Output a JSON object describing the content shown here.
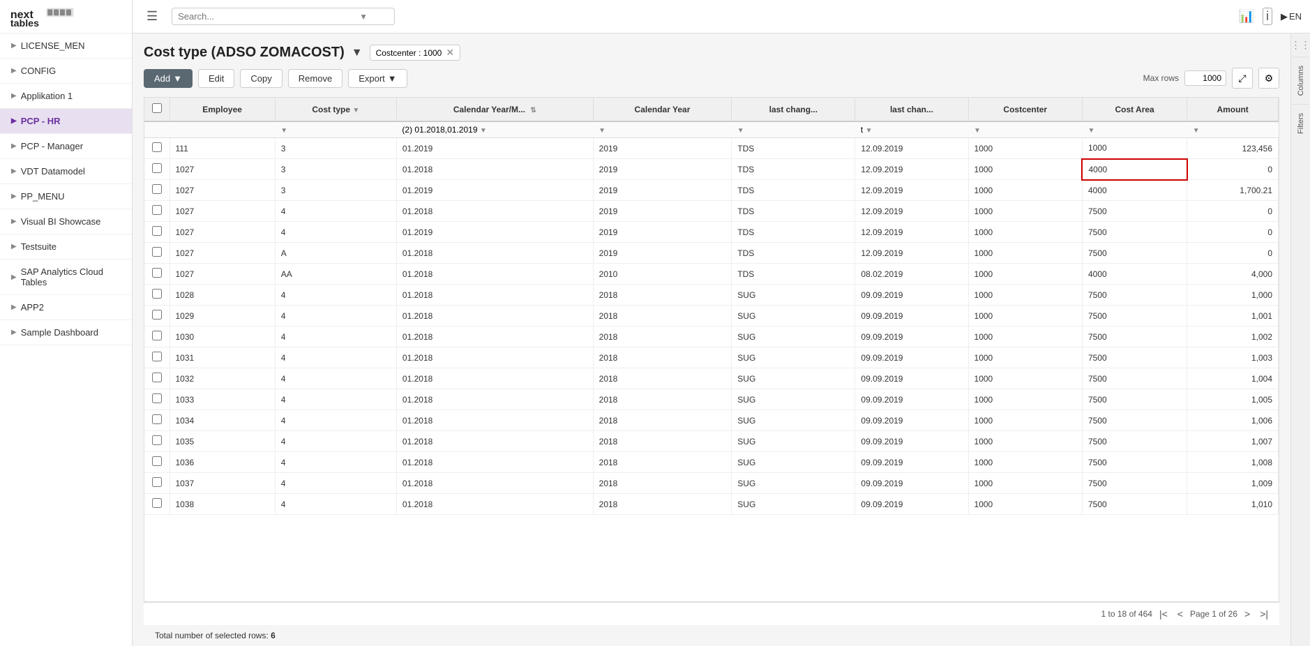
{
  "logo": {
    "alt": "next tables"
  },
  "topbar": {
    "search_placeholder": "Search...",
    "lang": "EN"
  },
  "sidebar": {
    "items": [
      {
        "id": "license-men",
        "label": "LICENSE_MEN",
        "active": false
      },
      {
        "id": "config",
        "label": "CONFIG",
        "active": false
      },
      {
        "id": "applikation-1",
        "label": "Applikation 1",
        "active": false
      },
      {
        "id": "pcp-hr",
        "label": "PCP - HR",
        "active": true
      },
      {
        "id": "pcp-manager",
        "label": "PCP - Manager",
        "active": false
      },
      {
        "id": "vdt-datamodel",
        "label": "VDT Datamodel",
        "active": false
      },
      {
        "id": "pp-menu",
        "label": "PP_MENU",
        "active": false
      },
      {
        "id": "visual-bi-showcase",
        "label": "Visual BI Showcase",
        "active": false
      },
      {
        "id": "testsuite",
        "label": "Testsuite",
        "active": false
      },
      {
        "id": "sap-analytics-cloud-tables",
        "label": "SAP Analytics Cloud Tables",
        "active": false
      },
      {
        "id": "app2",
        "label": "APP2",
        "active": false
      },
      {
        "id": "sample-dashboard",
        "label": "Sample Dashboard",
        "active": false
      }
    ]
  },
  "page": {
    "title": "Cost type (ADSO ZOMACOST)",
    "filter_chip": "Costcenter : 1000"
  },
  "toolbar": {
    "add_label": "Add",
    "edit_label": "Edit",
    "copy_label": "Copy",
    "remove_label": "Remove",
    "export_label": "Export",
    "max_rows_label": "Max rows",
    "max_rows_value": "1000"
  },
  "table": {
    "columns": [
      {
        "id": "checkbox",
        "label": ""
      },
      {
        "id": "employee",
        "label": "Employee"
      },
      {
        "id": "cost_type",
        "label": "Cost type"
      },
      {
        "id": "calendar_year_m",
        "label": "Calendar Year/M..."
      },
      {
        "id": "calendar_year",
        "label": "Calendar Year"
      },
      {
        "id": "last_chang1",
        "label": "last chang..."
      },
      {
        "id": "last_chan2",
        "label": "last chan..."
      },
      {
        "id": "costcenter",
        "label": "Costcenter"
      },
      {
        "id": "cost_area",
        "label": "Cost Area"
      },
      {
        "id": "amount",
        "label": "Amount"
      }
    ],
    "filter_row": {
      "calendar_year_m_filter": "(2) 01.2018,01.2019",
      "last_chan2_filter": "t"
    },
    "rows": [
      {
        "employee": "111",
        "cost_type": "3",
        "calendar_year_m": "01.2019",
        "calendar_year": "2019",
        "last_chang1": "TDS",
        "last_chan2": "12.09.2019",
        "costcenter": "1000",
        "cost_area": "1000",
        "amount": "123,456"
      },
      {
        "employee": "1027",
        "cost_type": "3",
        "calendar_year_m": "01.2018",
        "calendar_year": "2019",
        "last_chang1": "TDS",
        "last_chan2": "12.09.2019",
        "costcenter": "1000",
        "cost_area": "4000",
        "amount": "0",
        "highlight_cost_area": true
      },
      {
        "employee": "1027",
        "cost_type": "3",
        "calendar_year_m": "01.2019",
        "calendar_year": "2019",
        "last_chang1": "TDS",
        "last_chan2": "12.09.2019",
        "costcenter": "1000",
        "cost_area": "4000",
        "amount": "1,700.21"
      },
      {
        "employee": "1027",
        "cost_type": "4",
        "calendar_year_m": "01.2018",
        "calendar_year": "2019",
        "last_chang1": "TDS",
        "last_chan2": "12.09.2019",
        "costcenter": "1000",
        "cost_area": "7500",
        "amount": "0"
      },
      {
        "employee": "1027",
        "cost_type": "4",
        "calendar_year_m": "01.2019",
        "calendar_year": "2019",
        "last_chang1": "TDS",
        "last_chan2": "12.09.2019",
        "costcenter": "1000",
        "cost_area": "7500",
        "amount": "0"
      },
      {
        "employee": "1027",
        "cost_type": "A",
        "calendar_year_m": "01.2018",
        "calendar_year": "2019",
        "last_chang1": "TDS",
        "last_chan2": "12.09.2019",
        "costcenter": "1000",
        "cost_area": "7500",
        "amount": "0"
      },
      {
        "employee": "1027",
        "cost_type": "AA",
        "calendar_year_m": "01.2018",
        "calendar_year": "2010",
        "last_chang1": "TDS",
        "last_chan2": "08.02.2019",
        "costcenter": "1000",
        "cost_area": "4000",
        "amount": "4,000"
      },
      {
        "employee": "1028",
        "cost_type": "4",
        "calendar_year_m": "01.2018",
        "calendar_year": "2018",
        "last_chang1": "SUG",
        "last_chan2": "09.09.2019",
        "costcenter": "1000",
        "cost_area": "7500",
        "amount": "1,000"
      },
      {
        "employee": "1029",
        "cost_type": "4",
        "calendar_year_m": "01.2018",
        "calendar_year": "2018",
        "last_chang1": "SUG",
        "last_chan2": "09.09.2019",
        "costcenter": "1000",
        "cost_area": "7500",
        "amount": "1,001"
      },
      {
        "employee": "1030",
        "cost_type": "4",
        "calendar_year_m": "01.2018",
        "calendar_year": "2018",
        "last_chang1": "SUG",
        "last_chan2": "09.09.2019",
        "costcenter": "1000",
        "cost_area": "7500",
        "amount": "1,002"
      },
      {
        "employee": "1031",
        "cost_type": "4",
        "calendar_year_m": "01.2018",
        "calendar_year": "2018",
        "last_chang1": "SUG",
        "last_chan2": "09.09.2019",
        "costcenter": "1000",
        "cost_area": "7500",
        "amount": "1,003"
      },
      {
        "employee": "1032",
        "cost_type": "4",
        "calendar_year_m": "01.2018",
        "calendar_year": "2018",
        "last_chang1": "SUG",
        "last_chan2": "09.09.2019",
        "costcenter": "1000",
        "cost_area": "7500",
        "amount": "1,004"
      },
      {
        "employee": "1033",
        "cost_type": "4",
        "calendar_year_m": "01.2018",
        "calendar_year": "2018",
        "last_chang1": "SUG",
        "last_chan2": "09.09.2019",
        "costcenter": "1000",
        "cost_area": "7500",
        "amount": "1,005"
      },
      {
        "employee": "1034",
        "cost_type": "4",
        "calendar_year_m": "01.2018",
        "calendar_year": "2018",
        "last_chang1": "SUG",
        "last_chan2": "09.09.2019",
        "costcenter": "1000",
        "cost_area": "7500",
        "amount": "1,006"
      },
      {
        "employee": "1035",
        "cost_type": "4",
        "calendar_year_m": "01.2018",
        "calendar_year": "2018",
        "last_chang1": "SUG",
        "last_chan2": "09.09.2019",
        "costcenter": "1000",
        "cost_area": "7500",
        "amount": "1,007"
      },
      {
        "employee": "1036",
        "cost_type": "4",
        "calendar_year_m": "01.2018",
        "calendar_year": "2018",
        "last_chang1": "SUG",
        "last_chan2": "09.09.2019",
        "costcenter": "1000",
        "cost_area": "7500",
        "amount": "1,008"
      },
      {
        "employee": "1037",
        "cost_type": "4",
        "calendar_year_m": "01.2018",
        "calendar_year": "2018",
        "last_chang1": "SUG",
        "last_chan2": "09.09.2019",
        "costcenter": "1000",
        "cost_area": "7500",
        "amount": "1,009"
      },
      {
        "employee": "1038",
        "cost_type": "4",
        "calendar_year_m": "01.2018",
        "calendar_year": "2018",
        "last_chang1": "SUG",
        "last_chan2": "09.09.2019",
        "costcenter": "1000",
        "cost_area": "7500",
        "amount": "1,010"
      }
    ]
  },
  "footer": {
    "pagination_info": "1 to 18 of 464",
    "page_info": "Page 1 of 26",
    "selected_rows_label": "Total number of selected rows:",
    "selected_rows_count": "6"
  },
  "right_panel": {
    "columns_label": "Columns",
    "filters_label": "Filters"
  }
}
